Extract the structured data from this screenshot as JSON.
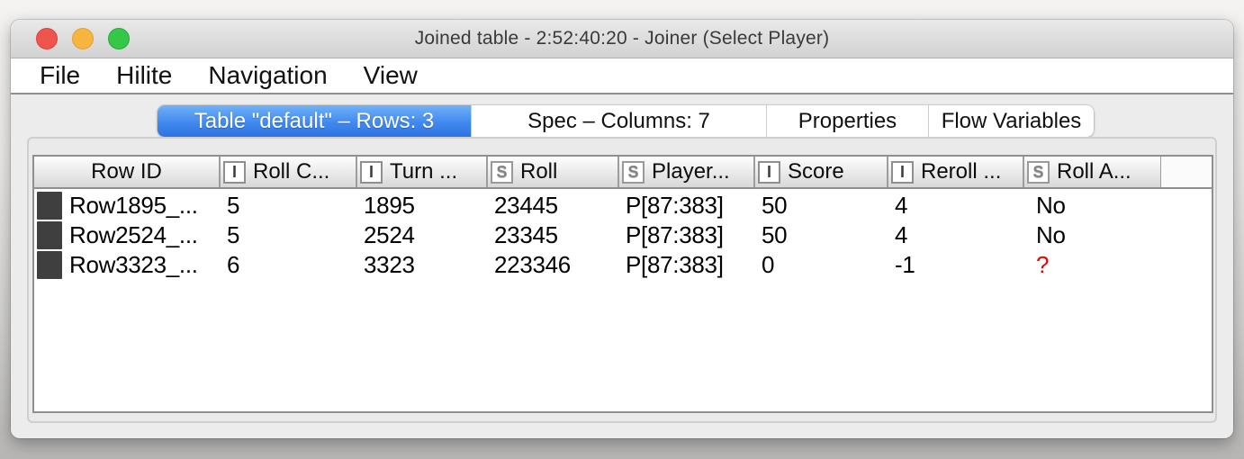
{
  "window": {
    "title": "Joined table - 2:52:40:20 - Joiner (Select Player)",
    "traffic_lights": {
      "close": "#f0544e",
      "minimize": "#f6b53e",
      "zoom": "#35c748"
    }
  },
  "menu": {
    "items": [
      "File",
      "Hilite",
      "Navigation",
      "View"
    ]
  },
  "tabs": [
    {
      "label": "Table \"default\" – Rows: 3",
      "selected": true
    },
    {
      "label": "Spec – Columns: 7",
      "selected": false
    },
    {
      "label": "Properties",
      "selected": false
    },
    {
      "label": "Flow Variables",
      "selected": false
    }
  ],
  "table": {
    "columns": [
      {
        "label": "Row ID",
        "type": ""
      },
      {
        "label": "Roll C...",
        "type": "I"
      },
      {
        "label": "Turn ...",
        "type": "I"
      },
      {
        "label": "Roll",
        "type": "S"
      },
      {
        "label": "Player...",
        "type": "S"
      },
      {
        "label": "Score",
        "type": "I"
      },
      {
        "label": "Reroll ...",
        "type": "I"
      },
      {
        "label": "Roll A...",
        "type": "S"
      }
    ],
    "rows": [
      {
        "id": "Row1895_...",
        "cells": [
          "5",
          "1895",
          "23445",
          "P[87:383]",
          "50",
          "4",
          "No"
        ]
      },
      {
        "id": "Row2524_...",
        "cells": [
          "5",
          "2524",
          "23345",
          "P[87:383]",
          "50",
          "4",
          "No"
        ]
      },
      {
        "id": "Row3323_...",
        "cells": [
          "6",
          "3323",
          "223346",
          "P[87:383]",
          "0",
          "-1",
          "?"
        ]
      }
    ]
  },
  "colors": {
    "selected_tab_blue": "#4189ef",
    "missing_value_red": "#f00000",
    "hilite_chip_gray": "#3f3f3f"
  }
}
